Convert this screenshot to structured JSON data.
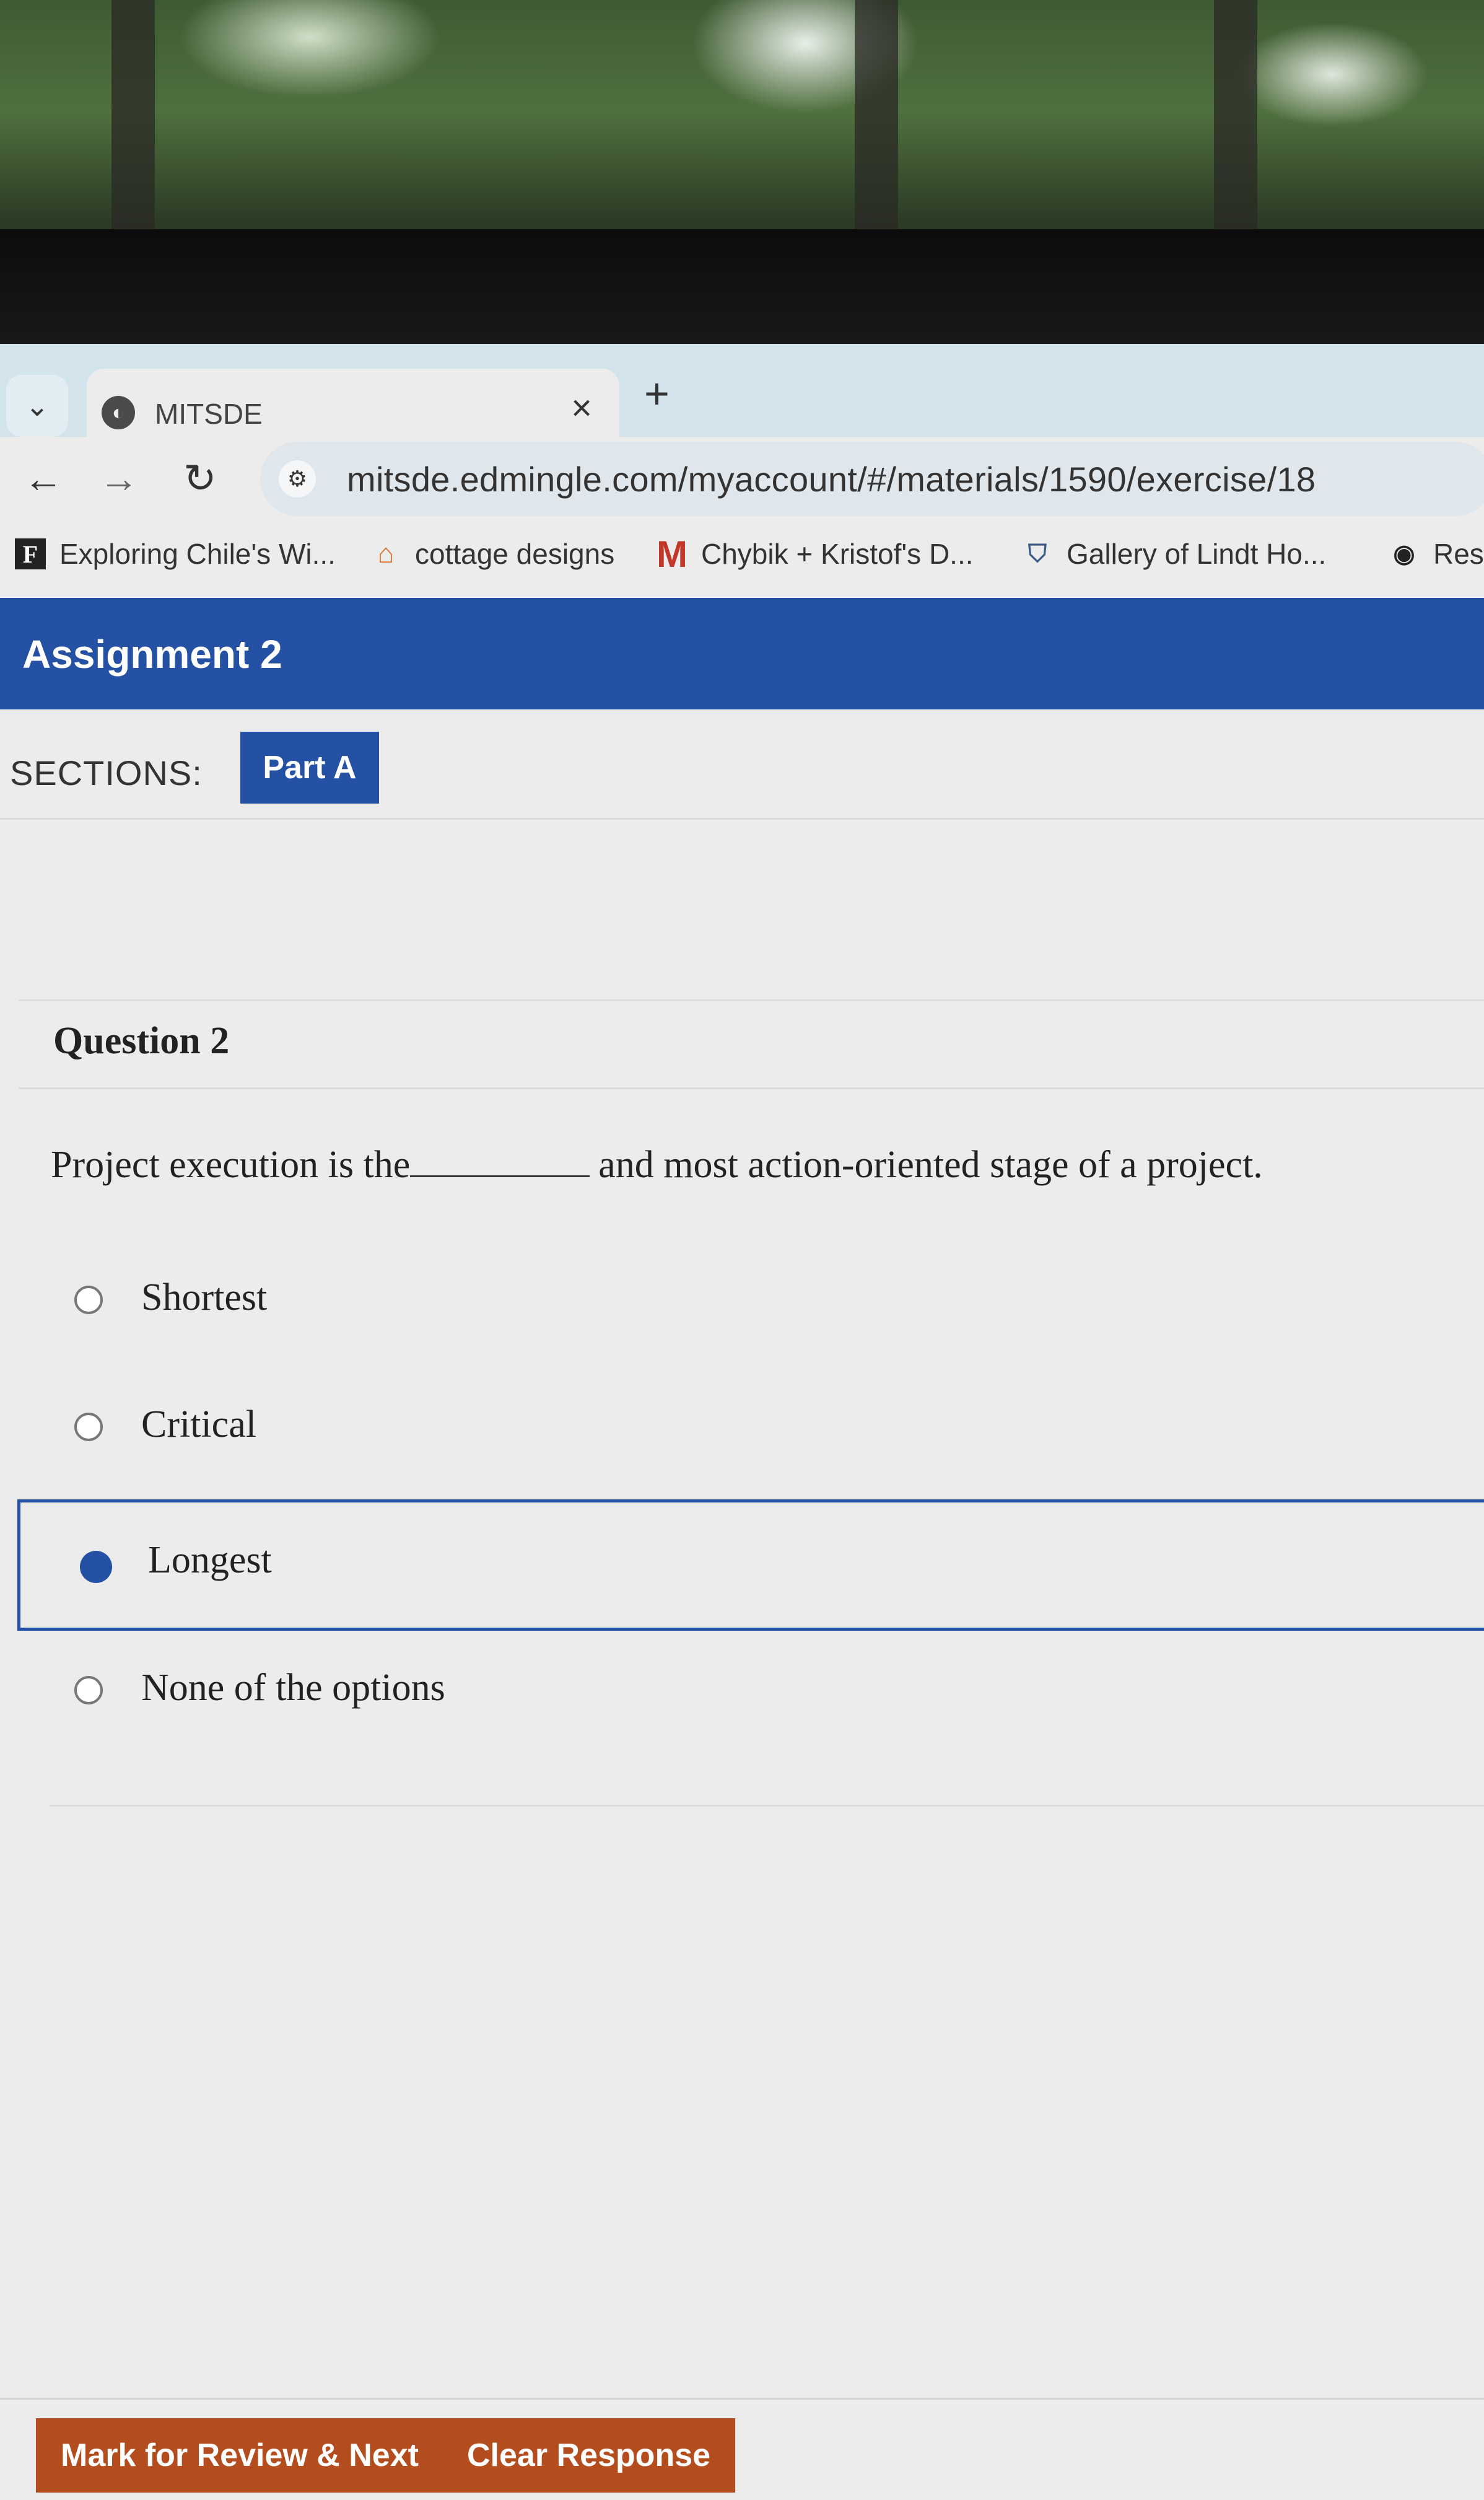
{
  "browser": {
    "tab": {
      "title": "MITSDE",
      "close_glyph": "×"
    },
    "new_tab_glyph": "+",
    "url": "mitsde.edmingle.com/myaccount/#/materials/1590/exercise/18",
    "bookmarks": [
      {
        "label": "Exploring Chile's Wi...",
        "icon": "F"
      },
      {
        "label": "cottage designs",
        "icon": "house"
      },
      {
        "label": "Chybik + Kristof's D...",
        "icon": "M"
      },
      {
        "label": "Gallery of Lindt Ho...",
        "icon": "shield"
      },
      {
        "label": "Res",
        "icon": "globe"
      }
    ]
  },
  "page": {
    "assignment_title": "Assignment 2",
    "sections_label": "SECTIONS:",
    "section_button": "Part A",
    "question_title": "Question 2",
    "question_before_blank": "Project execution is the",
    "question_after_blank": "and most action-oriented stage of a project.",
    "options": [
      {
        "label": "Shortest",
        "selected": false
      },
      {
        "label": "Critical",
        "selected": false
      },
      {
        "label": "Longest",
        "selected": true
      },
      {
        "label": "None of the options",
        "selected": false
      }
    ],
    "footer": {
      "mark_review_label": "Mark for Review & Next",
      "clear_label": "Clear Response"
    }
  },
  "colors": {
    "brand_blue": "#2451a4",
    "action_orange": "#b34d1d"
  }
}
